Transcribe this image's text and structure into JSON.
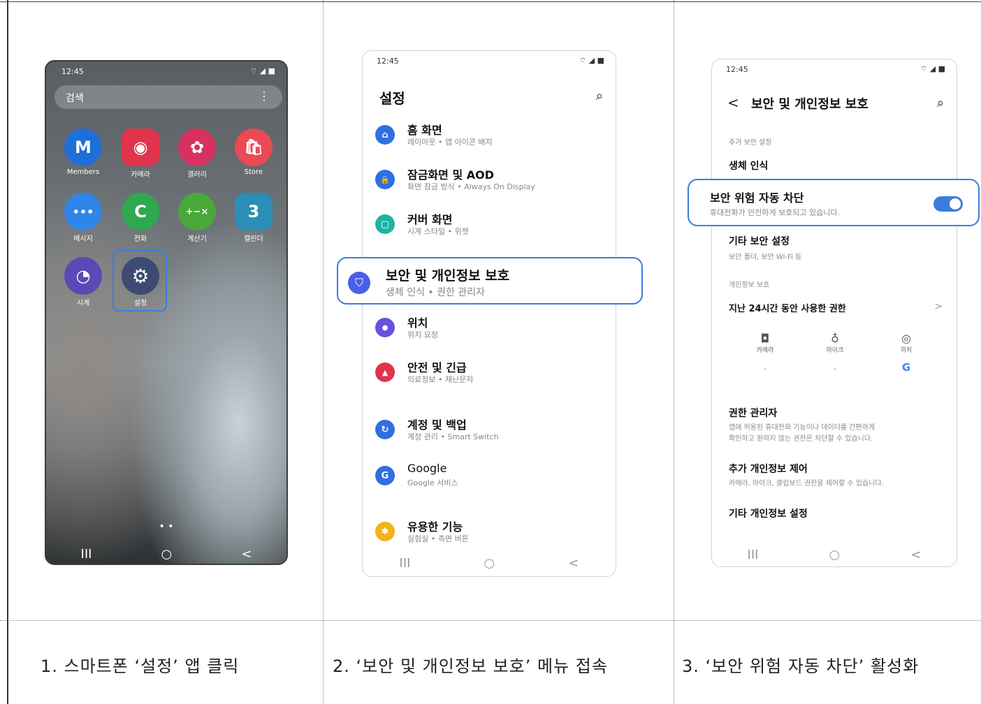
{
  "phone1": {
    "time": "12:45",
    "status_icons": "⌔ ◢ ■",
    "search_label": "검색",
    "apps": [
      {
        "label": "Members",
        "glyph": "M",
        "color": "#1e6fd9"
      },
      {
        "label": "카메라",
        "glyph": "◉",
        "color": "#e0344c"
      },
      {
        "label": "갤러리",
        "glyph": "✿",
        "color": "#d8315f"
      },
      {
        "label": "Store",
        "glyph": "🛍",
        "color": "#ea4a55"
      },
      {
        "label": "메시지",
        "glyph": "•••",
        "color": "#2f86e8"
      },
      {
        "label": "전화",
        "glyph": "C",
        "color": "#2fa84f"
      },
      {
        "label": "계산기",
        "glyph": "+−×",
        "color": "#49a83a"
      },
      {
        "label": "캘린더",
        "glyph": "3",
        "color": "#2b8eb5"
      },
      {
        "label": "시계",
        "glyph": "◔",
        "color": "#5a4ab5"
      },
      {
        "label": "설정",
        "glyph": "⚙",
        "color": "#3d4a73"
      }
    ],
    "page_dots": "• •",
    "nav": [
      "III",
      "○",
      "<"
    ]
  },
  "phone2": {
    "time": "12:45",
    "status_icons": "⌔ ◢ ■",
    "title": "설정",
    "items": [
      {
        "title": "홈 화면",
        "sub": "레이아웃 • 앱 아이콘 배지",
        "color": "#2f6fe0",
        "glyph": "⌂"
      },
      {
        "title": "잠금화면 및 AOD",
        "sub": "화면 잠금 방식 • Always On Display",
        "color": "#2f6fe0",
        "glyph": "🔒"
      },
      {
        "title": "커버 화면",
        "sub": "시계 스타일 • 위젯",
        "color": "#1eb3a6",
        "glyph": "▢"
      },
      {
        "title": "위치",
        "sub": "위치 요청",
        "color": "#6a4fe0",
        "glyph": "●"
      },
      {
        "title": "안전 및 긴급",
        "sub": "의료정보 • 재난문자",
        "color": "#e0344c",
        "glyph": "▲"
      },
      {
        "title": "계정 및 백업",
        "sub": "계정 관리 • Smart Switch",
        "color": "#2f6fe0",
        "glyph": "↻"
      },
      {
        "title": "Google",
        "sub": "Google 서비스",
        "color": "#2f6fe0",
        "glyph": "G"
      },
      {
        "title": "유용한 기능",
        "sub": "실험실 • 측면 버튼",
        "color": "#f2b21b",
        "glyph": "✱"
      }
    ],
    "highlight": {
      "title": "보안 및 개인정보 보호",
      "sub": "생체 인식 • 권한 관리자",
      "color": "#4a5ee8",
      "glyph": "⛉"
    },
    "nav": [
      "III",
      "○",
      "<"
    ]
  },
  "phone3": {
    "time": "12:45",
    "status_icons": "⌔ ◢ ■",
    "back": "<",
    "title": "보안 및 개인정보 보호",
    "sec_extra": "추가 보안 설정",
    "biometric": "생체 인식",
    "highlight": {
      "title": "보안 위험 자동 차단",
      "sub": "휴대전화가 안전하게 보호되고 있습니다.",
      "toggle_on": true
    },
    "other_sec": {
      "title": "기타 보안 설정",
      "sub": "보안 폴더, 보안 Wi-Fi 등"
    },
    "sec_privacy": "개인정보 보호",
    "last24": "지난 24시간 동안 사용한 권한",
    "chevron": ">",
    "perms": [
      {
        "label": "카메라",
        "glyph": "◘",
        "value": "-"
      },
      {
        "label": "마이크",
        "glyph": "♁",
        "value": "-"
      },
      {
        "label": "위치",
        "glyph": "◎",
        "value": "G"
      }
    ],
    "perm_mgr": {
      "title": "권한 관리자",
      "sub1": "앱에 허용된 휴대전화 기능이나 데이터를 간편하게",
      "sub2": "확인하고 원하지 않는 권한은 차단할 수 있습니다."
    },
    "extra_priv": {
      "title": "추가 개인정보 제어",
      "sub": "카메라, 마이크, 클립보드 권한을 제어할 수 있습니다."
    },
    "other_priv": "기타 개인정보 설정",
    "nav": [
      "III",
      "○",
      "<"
    ]
  },
  "captions": [
    "1. 스마트폰 ‘설정’ 앱 클릭",
    "2. ‘보안 및 개인정보 보호’ 메뉴 접속",
    "3. ‘보안 위험 자동 차단’ 활성화"
  ]
}
